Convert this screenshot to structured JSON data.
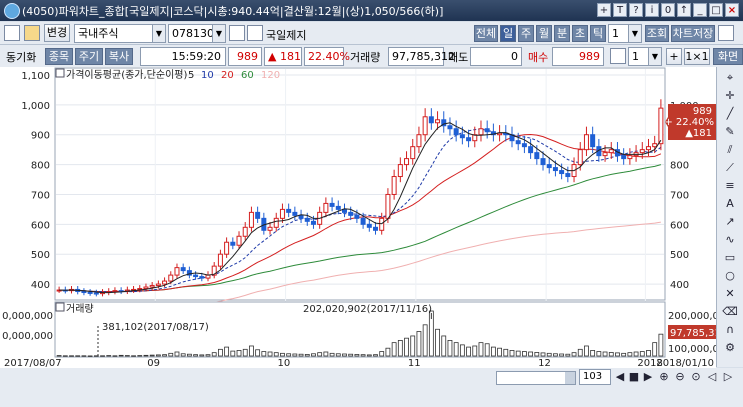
{
  "window": {
    "title": "(4050)파워차트_종합[국일제지|코스닥|시총:940.44억|결산월:12월|(상)1,050/566(하)]"
  },
  "title_buttons": [
    "+",
    "T",
    "?",
    "i",
    "0",
    "↑",
    "_",
    "□",
    "×"
  ],
  "toolbar1": {
    "change_label": "변경",
    "market": "국내주식",
    "code": "078130",
    "stock_name": "국일제지",
    "period_buttons": [
      "전체",
      "일",
      "주",
      "월",
      "분",
      "초",
      "틱"
    ],
    "period_active": "일",
    "interval": "1",
    "query_label": "조회",
    "save_label": "차트저장"
  },
  "toolbar2": {
    "sync_label": "동기화",
    "tabs": [
      "종목",
      "주기",
      "복사"
    ],
    "time": "15:59:20",
    "price": "989",
    "change": "▲ 181",
    "change_pct": "22.40%",
    "volume_label": "거래량",
    "volume": "97,785,312",
    "sell_label": "매도",
    "sell_value": "0",
    "buy_label": "매수",
    "buy_value": "989",
    "count": "1",
    "plus_label": "+",
    "ratio_label": "1×1",
    "extra_label": "화면"
  },
  "price_panel": {
    "legend_title": "가격이동평균(종가,단순이평)",
    "ma_periods": [
      "5",
      "10",
      "20",
      "60",
      "120"
    ],
    "ma_colors": [
      "#222222",
      "#1f3aa8",
      "#d42020",
      "#2e8b3a",
      "#f0b0b0"
    ],
    "y_ticks": [
      "1,100",
      "1,000",
      "900",
      "800",
      "700",
      "600",
      "500",
      "400"
    ],
    "right_ticks": [
      "1,000",
      "900",
      "800",
      "700",
      "600",
      "500",
      "400"
    ],
    "price_tag": {
      "price": "989",
      "pct": "+ 22.40%",
      "change": "▲181"
    }
  },
  "volume_panel": {
    "legend_title": "거래량",
    "y_ticks": [
      "0,000,000",
      "0,000,000"
    ],
    "right_ticks": [
      "200,000,000",
      "100,000,000"
    ],
    "right_value": "97,785,31",
    "annotation_high": "202,020,902(2017/11/16)",
    "annotation_low": "381,102(2017/08/17)"
  },
  "x_axis": {
    "start_date": "2017/08/07",
    "end_date": "2018/01/10",
    "month_labels": [
      "09",
      "10",
      "11",
      "12",
      "2018"
    ]
  },
  "bottom": {
    "zoom_value": "103"
  },
  "chart_data": {
    "type": "candlestick",
    "title": "가격이동평균(종가,단순이평)",
    "x_range": [
      "2017/08/07",
      "2018/01/10"
    ],
    "ylim": [
      350,
      1120
    ],
    "series": [
      {
        "name": "5",
        "color": "#222222"
      },
      {
        "name": "10",
        "color": "#1f3aa8"
      },
      {
        "name": "20",
        "color": "#d42020"
      },
      {
        "name": "60",
        "color": "#2e8b3a"
      },
      {
        "name": "120",
        "color": "#f0b0b0"
      }
    ],
    "close": [
      380,
      378,
      382,
      375,
      372,
      370,
      368,
      372,
      375,
      378,
      376,
      380,
      382,
      385,
      390,
      395,
      400,
      410,
      430,
      455,
      445,
      430,
      425,
      420,
      430,
      460,
      500,
      540,
      530,
      560,
      590,
      640,
      620,
      580,
      590,
      620,
      650,
      640,
      630,
      620,
      610,
      600,
      640,
      670,
      660,
      650,
      640,
      630,
      620,
      600,
      590,
      580,
      620,
      700,
      760,
      800,
      820,
      860,
      900,
      960,
      940,
      950,
      930,
      920,
      900,
      890,
      880,
      900,
      920,
      910,
      900,
      905,
      900,
      880,
      870,
      860,
      840,
      820,
      800,
      790,
      780,
      770,
      760,
      800,
      850,
      900,
      860,
      830,
      840,
      850,
      830,
      820,
      830,
      840,
      850,
      860,
      870,
      989
    ],
    "volume_ylim": [
      0,
      220000000
    ],
    "volume": [
      2,
      1,
      1,
      1,
      1,
      0.4,
      1,
      1,
      2,
      1,
      3,
      2,
      1,
      2,
      3,
      4,
      5,
      6,
      12,
      18,
      10,
      8,
      6,
      5,
      6,
      15,
      30,
      40,
      22,
      25,
      30,
      45,
      28,
      20,
      18,
      15,
      12,
      10,
      9,
      8,
      7,
      10,
      15,
      18,
      12,
      10,
      9,
      8,
      7,
      6,
      5,
      6,
      20,
      35,
      60,
      70,
      80,
      90,
      110,
      140,
      202,
      120,
      90,
      70,
      60,
      50,
      40,
      45,
      60,
      55,
      40,
      35,
      30,
      25,
      22,
      20,
      18,
      16,
      14,
      12,
      10,
      9,
      8,
      15,
      30,
      45,
      25,
      20,
      18,
      16,
      14,
      12,
      15,
      18,
      20,
      25,
      60,
      98
    ],
    "annotations": [
      {
        "label": "202,020,902(2017/11/16)",
        "type": "max"
      },
      {
        "label": "381,102(2017/08/17)",
        "type": "min"
      }
    ]
  }
}
